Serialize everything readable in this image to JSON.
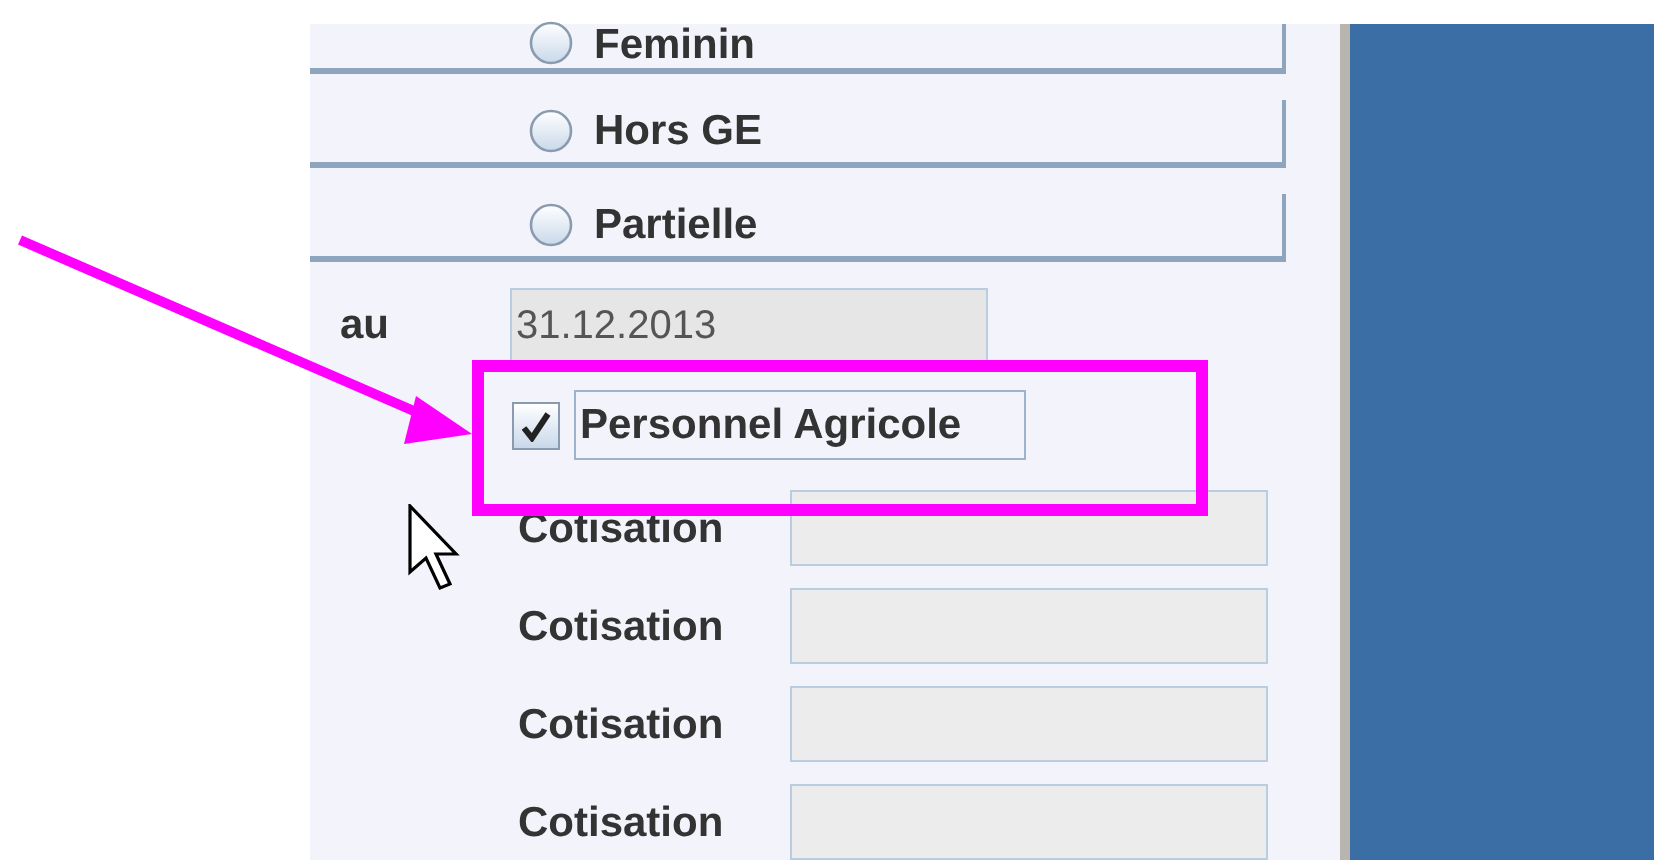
{
  "options": [
    {
      "label": "Feminin",
      "selected": false
    },
    {
      "label": "Hors GE",
      "selected": false
    },
    {
      "label": "Partielle",
      "selected": false
    }
  ],
  "date_to": {
    "label": "au",
    "value": "31.12.2013"
  },
  "personnel_agricole": {
    "label": "Personnel Agricole",
    "checked": true,
    "focused": true
  },
  "cotisations": [
    {
      "label": "Cotisation"
    },
    {
      "label": "Cotisation"
    },
    {
      "label": "Cotisation"
    },
    {
      "label": "Cotisation"
    }
  ]
}
